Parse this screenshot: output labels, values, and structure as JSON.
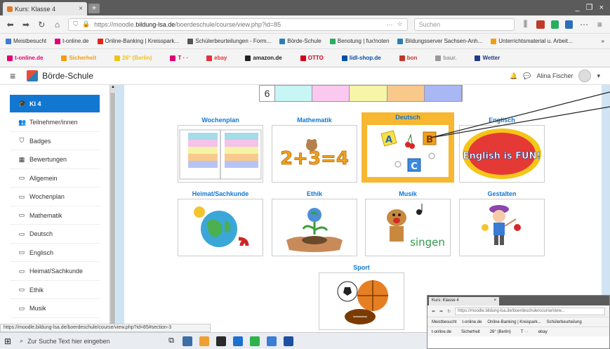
{
  "browser": {
    "tab_title": "Kurs: Klasse 4",
    "tab_close": "×",
    "new_tab": "+",
    "window_controls": "_ ❐ ×",
    "url_prefix": "https://moodle.",
    "url_domain": "bildung-lsa.de",
    "url_path": "/boerdeschule/course/view.php?id=85",
    "url_more": "···",
    "search_placeholder": "Suchen"
  },
  "bookmarks": [
    {
      "label": "Meistbesucht",
      "color": "#3b7dd8"
    },
    {
      "label": "t-online.de",
      "color": "#e20074"
    },
    {
      "label": "Online-Banking | Kreisspark...",
      "color": "#e2231a"
    },
    {
      "label": "Schülerbeurteilungen - Form...",
      "color": "#555555"
    },
    {
      "label": "Börde-Schule",
      "color": "#2980b9"
    },
    {
      "label": "Benotung | fux!noten",
      "color": "#27ae60"
    },
    {
      "label": "Bildungsserver Sachsen-Anh...",
      "color": "#2980b9"
    },
    {
      "label": "Unterrichtsmaterial u. Arbeit...",
      "color": "#f39c12"
    }
  ],
  "extensions": [
    {
      "label": "t-online.de",
      "color": "#e20074"
    },
    {
      "label": "Sicherheit",
      "color": "#f39c12"
    },
    {
      "label": "26° (Berlin)",
      "color": "#f1c40f"
    },
    {
      "label": "T · ·",
      "color": "#e20074"
    },
    {
      "label": "ebay",
      "color": "#e53238"
    },
    {
      "label": "amazon.de",
      "color": "#222222"
    },
    {
      "label": "OTTO",
      "color": "#d4001a"
    },
    {
      "label": "lidl-shop.de",
      "color": "#0050aa"
    },
    {
      "label": "bon",
      "color": "#c0392b"
    },
    {
      "label": "baur.",
      "color": "#999999"
    },
    {
      "label": "Wetter",
      "color": "#1e3a8a"
    }
  ],
  "moodle": {
    "site_name": "Börde-Schule",
    "user_name": "Alina Fischer"
  },
  "sidebar": {
    "items": [
      {
        "label": "Kl 4",
        "icon": "graduation-cap-icon",
        "glyph": "🎓",
        "active": true
      },
      {
        "label": "Teilnehmer/innen",
        "icon": "users-icon",
        "glyph": "👥"
      },
      {
        "label": "Badges",
        "icon": "shield-icon",
        "glyph": "⛉"
      },
      {
        "label": "Bewertungen",
        "icon": "table-icon",
        "glyph": "▦"
      },
      {
        "label": "Allgemein",
        "icon": "folder-icon",
        "glyph": "▭"
      },
      {
        "label": "Wochenplan",
        "icon": "folder-icon",
        "glyph": "▭"
      },
      {
        "label": "Mathematik",
        "icon": "folder-icon",
        "glyph": "▭"
      },
      {
        "label": "Deutsch",
        "icon": "folder-icon",
        "glyph": "▭"
      },
      {
        "label": "Englisch",
        "icon": "folder-icon",
        "glyph": "▭"
      },
      {
        "label": "Heimat/Sachkunde",
        "icon": "folder-icon",
        "glyph": "▭"
      },
      {
        "label": "Ethik",
        "icon": "folder-icon",
        "glyph": "▭"
      },
      {
        "label": "Musik",
        "icon": "folder-icon",
        "glyph": "▭"
      }
    ]
  },
  "strip": {
    "number": "6",
    "colors": [
      "#c8f5f5",
      "#fbc8f0",
      "#f7f5a8",
      "#f9c98c",
      "#a9b8f5"
    ]
  },
  "cards": {
    "wochenplan": "Wochenplan",
    "mathematik": "Mathematik",
    "deutsch": "Deutsch",
    "englisch": "Englisch",
    "heimat": "Heimat/Sachkunde",
    "ethik": "Ethik",
    "musik": "Musik",
    "gestalten": "Gestalten",
    "sport": "Sport",
    "math_text": "2+3=4",
    "english_text": "English is FUN!",
    "singen_text": "singen",
    "deutsch_letters": [
      "A",
      "B",
      "C"
    ]
  },
  "status_url": "https://moodle.bildung-lsa.de/boerdeschule/course/view.php?id=85#section-3",
  "taskbar": {
    "search_placeholder": "Zur Suche Text hier eingeben",
    "apps": [
      "#3b6ea5",
      "#f0a030",
      "#2a2a2a",
      "#1f6fd0",
      "#2db34a",
      "#3b7dd8",
      "#1e4fa0"
    ]
  },
  "mini_window": {
    "tab_title": "Kurs: Klasse 4",
    "url": "https://moodle.bildung-lsa.de/boerdeschule/course/view...",
    "bookmarks": [
      "Meistbesucht",
      "t-online.de",
      "Online-Banking | Kreispark...",
      "Schülerbeurteilung"
    ],
    "extensions": [
      "t-online.de",
      "Sicherheit",
      "26° (Berlin)",
      "T · ·",
      "ebay"
    ]
  }
}
